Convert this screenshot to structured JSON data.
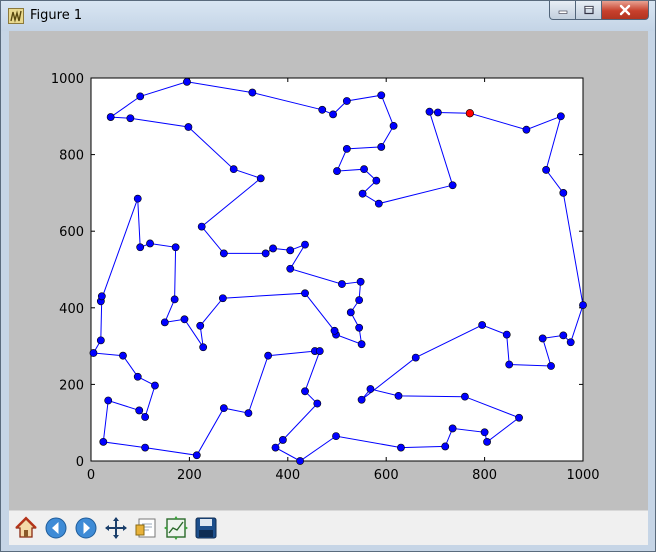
{
  "window": {
    "title": "Figure 1",
    "icon": "matplotlib-figure-icon",
    "controls": [
      "minimize-icon",
      "maximize-icon",
      "close-icon"
    ]
  },
  "toolbar": {
    "buttons": [
      "home-icon",
      "back-arrow-icon",
      "forward-arrow-icon",
      "pan-icon",
      "zoom-rect-icon",
      "subplots-config-icon",
      "save-icon"
    ]
  },
  "chart_data": {
    "type": "line",
    "title": "",
    "xlabel": "",
    "ylabel": "",
    "xlim": [
      0,
      1000
    ],
    "ylim": [
      0,
      1000
    ],
    "xticks": [
      "0",
      "200",
      "400",
      "600",
      "800",
      "1000"
    ],
    "yticks": [
      "0",
      "200",
      "400",
      "600",
      "800",
      "1000"
    ],
    "grid": false,
    "line_color": "#0000ff",
    "marker_color": "#0000ff",
    "highlight_color": "#ff0000",
    "highlight_point": [
      770,
      908
    ],
    "series": [
      {
        "points": [
          [
            770,
            908
          ],
          [
            705,
            910
          ],
          [
            688,
            912
          ],
          [
            735,
            720
          ],
          [
            585,
            672
          ],
          [
            552,
            698
          ],
          [
            580,
            732
          ],
          [
            555,
            762
          ],
          [
            500,
            757
          ],
          [
            520,
            815
          ],
          [
            590,
            820
          ],
          [
            615,
            875
          ],
          [
            590,
            955
          ],
          [
            520,
            940
          ],
          [
            492,
            905
          ],
          [
            470,
            917
          ],
          [
            328,
            962
          ],
          [
            195,
            990
          ],
          [
            100,
            952
          ],
          [
            40,
            898
          ],
          [
            80,
            895
          ],
          [
            198,
            872
          ],
          [
            290,
            762
          ],
          [
            345,
            738
          ],
          [
            225,
            612
          ],
          [
            270,
            542
          ],
          [
            355,
            542
          ],
          [
            370,
            555
          ],
          [
            405,
            550
          ],
          [
            435,
            565
          ],
          [
            405,
            502
          ],
          [
            510,
            462
          ],
          [
            548,
            468
          ],
          [
            545,
            420
          ],
          [
            528,
            388
          ],
          [
            545,
            348
          ],
          [
            550,
            305
          ],
          [
            498,
            330
          ],
          [
            495,
            340
          ],
          [
            435,
            438
          ],
          [
            268,
            425
          ],
          [
            222,
            353
          ],
          [
            228,
            297
          ],
          [
            190,
            370
          ],
          [
            150,
            362
          ],
          [
            170,
            422
          ],
          [
            172,
            558
          ],
          [
            120,
            568
          ],
          [
            100,
            558
          ],
          [
            95,
            685
          ],
          [
            20,
            417
          ],
          [
            22,
            430
          ],
          [
            20,
            315
          ],
          [
            5,
            282
          ],
          [
            65,
            275
          ],
          [
            95,
            220
          ],
          [
            130,
            197
          ],
          [
            110,
            115
          ],
          [
            98,
            132
          ],
          [
            35,
            158
          ],
          [
            25,
            50
          ],
          [
            110,
            35
          ],
          [
            215,
            15
          ],
          [
            270,
            138
          ],
          [
            320,
            125
          ],
          [
            360,
            275
          ],
          [
            455,
            287
          ],
          [
            465,
            287
          ],
          [
            435,
            182
          ],
          [
            460,
            150
          ],
          [
            390,
            55
          ],
          [
            375,
            35
          ],
          [
            425,
            0
          ],
          [
            498,
            65
          ],
          [
            630,
            35
          ],
          [
            720,
            38
          ],
          [
            735,
            85
          ],
          [
            800,
            75
          ],
          [
            805,
            50
          ],
          [
            870,
            113
          ],
          [
            760,
            168
          ],
          [
            625,
            170
          ],
          [
            568,
            188
          ],
          [
            550,
            160
          ],
          [
            660,
            270
          ],
          [
            795,
            355
          ],
          [
            845,
            330
          ],
          [
            850,
            252
          ],
          [
            935,
            248
          ],
          [
            918,
            320
          ],
          [
            960,
            328
          ],
          [
            975,
            310
          ],
          [
            1000,
            407
          ],
          [
            960,
            700
          ],
          [
            925,
            760
          ],
          [
            955,
            900
          ],
          [
            885,
            865
          ],
          [
            770,
            908
          ]
        ]
      }
    ]
  }
}
